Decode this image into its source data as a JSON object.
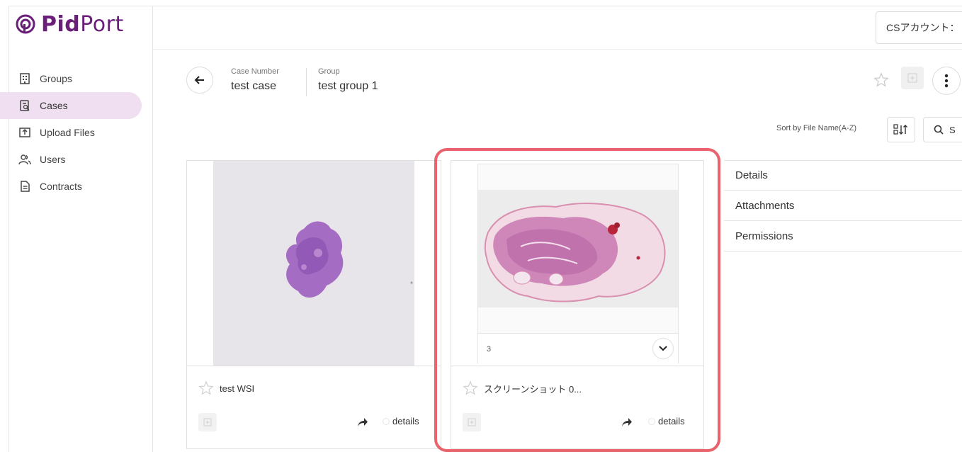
{
  "brand": {
    "name_bold": "Pid",
    "name_light": "Port",
    "color": "#6b1f7a"
  },
  "sidebar": {
    "items": [
      {
        "label": "Groups",
        "icon": "building-icon",
        "active": false
      },
      {
        "label": "Cases",
        "icon": "case-search-icon",
        "active": true
      },
      {
        "label": "Upload Files",
        "icon": "upload-icon",
        "active": false
      },
      {
        "label": "Users",
        "icon": "users-icon",
        "active": false
      },
      {
        "label": "Contracts",
        "icon": "document-icon",
        "active": false
      }
    ]
  },
  "topbar": {
    "account_label": "CSアカウント："
  },
  "case_header": {
    "case_number_label": "Case Number",
    "case_number_value": "test case",
    "group_label": "Group",
    "group_value": "test group 1"
  },
  "sort": {
    "label": "Sort by File Name(A-Z)",
    "search_label": "S"
  },
  "cards": [
    {
      "title": "test WSI",
      "details_label": "details"
    },
    {
      "title": "スクリーンショット 0...",
      "details_label": "details",
      "image_count": "3"
    }
  ],
  "panel": {
    "items": [
      "Details",
      "Attachments",
      "Permissions"
    ]
  },
  "colors": {
    "active_nav_bg": "#efdff0",
    "highlight_border": "#e8636b"
  }
}
